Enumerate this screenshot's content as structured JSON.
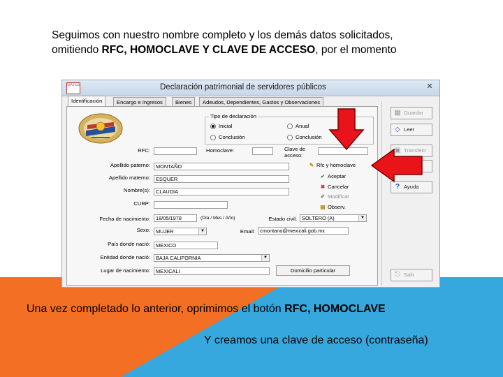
{
  "slide": {
    "top_text_line1": "Seguimos con nuestro nombre completo y los demás datos solicitados,",
    "top_text_line2_pre": "omitiendo ",
    "top_text_line2_bold": "RFC, HOMOCLAVE Y CLAVE DE ACCESO",
    "top_text_line2_post": ", por el momento",
    "bottom_text1_pre": "Una vez completado lo anterior, oprimimos el botón ",
    "bottom_text1_bold": "RFC, HOMOCLAVE",
    "bottom_text2": "Y creamos una clave de acceso (contraseña)",
    "colors": {
      "orange": "#f26f23",
      "blue": "#37a8de",
      "arrow_red": "#e8141a"
    }
  },
  "window": {
    "title": "Declaración patrimonial de servidores públicos",
    "app_icon_text": "SATLoyalty",
    "tabs": [
      {
        "label": "Identificación"
      },
      {
        "label": "Encargo e Ingresos"
      },
      {
        "label": "Bienes"
      },
      {
        "label": "Adeudos, Dependientes, Gastos y Observaciones"
      }
    ],
    "tipo": {
      "legend": "Tipo de declaración",
      "options": [
        "Inicial",
        "Anual",
        "Conclusión",
        "Conclusión"
      ]
    },
    "labels": {
      "rfc": "RFC:",
      "homoclave": "Homoclave:",
      "clave_acceso_1": "Clave de",
      "clave_acceso_2": "acceso:",
      "apellido_paterno": "Apellido paterno:",
      "apellido_materno": "Apellido materno:",
      "nombres": "Nombre(s):",
      "curp": "CURP:",
      "fecha_nacimiento": "Fecha de nacimiento:",
      "fecha_formato": "(Día / Mes / Año)",
      "estado_civil": "Estado civil:",
      "sexo": "Sexo:",
      "email": "Email:",
      "pais": "País donde nació:",
      "entidad": "Entidad donde nació:",
      "lugar": "Lugar de nacimiento:"
    },
    "values": {
      "rfc": "",
      "homoclave": "",
      "clave_acceso": "",
      "apellido_paterno": "MONTAÑO",
      "apellido_materno": "ESQUER",
      "nombres": "CLAUDIA",
      "curp": "",
      "fecha_nacimiento": "18/05/1978",
      "estado_civil": "SOLTERO (A)",
      "sexo": "MUJER",
      "email": "cmontano@mexicali.gob.mx",
      "pais": "MEXICO",
      "entidad": "BAJA CALIFORNIA",
      "lugar": "MEXICALI"
    },
    "action_buttons": {
      "rfc_homoclave": "Rfc y homoclave",
      "aceptar": "Aceptar",
      "cancelar": "Cancelar",
      "modificar": "Modificar",
      "observ": "Observ.",
      "domicilio": "Domicilio particular"
    },
    "side_buttons": {
      "guardar": "Guardar",
      "leer": "Leer",
      "transferir": "Transferir",
      "ayuda": "Ayuda",
      "salir": "Salir"
    }
  }
}
